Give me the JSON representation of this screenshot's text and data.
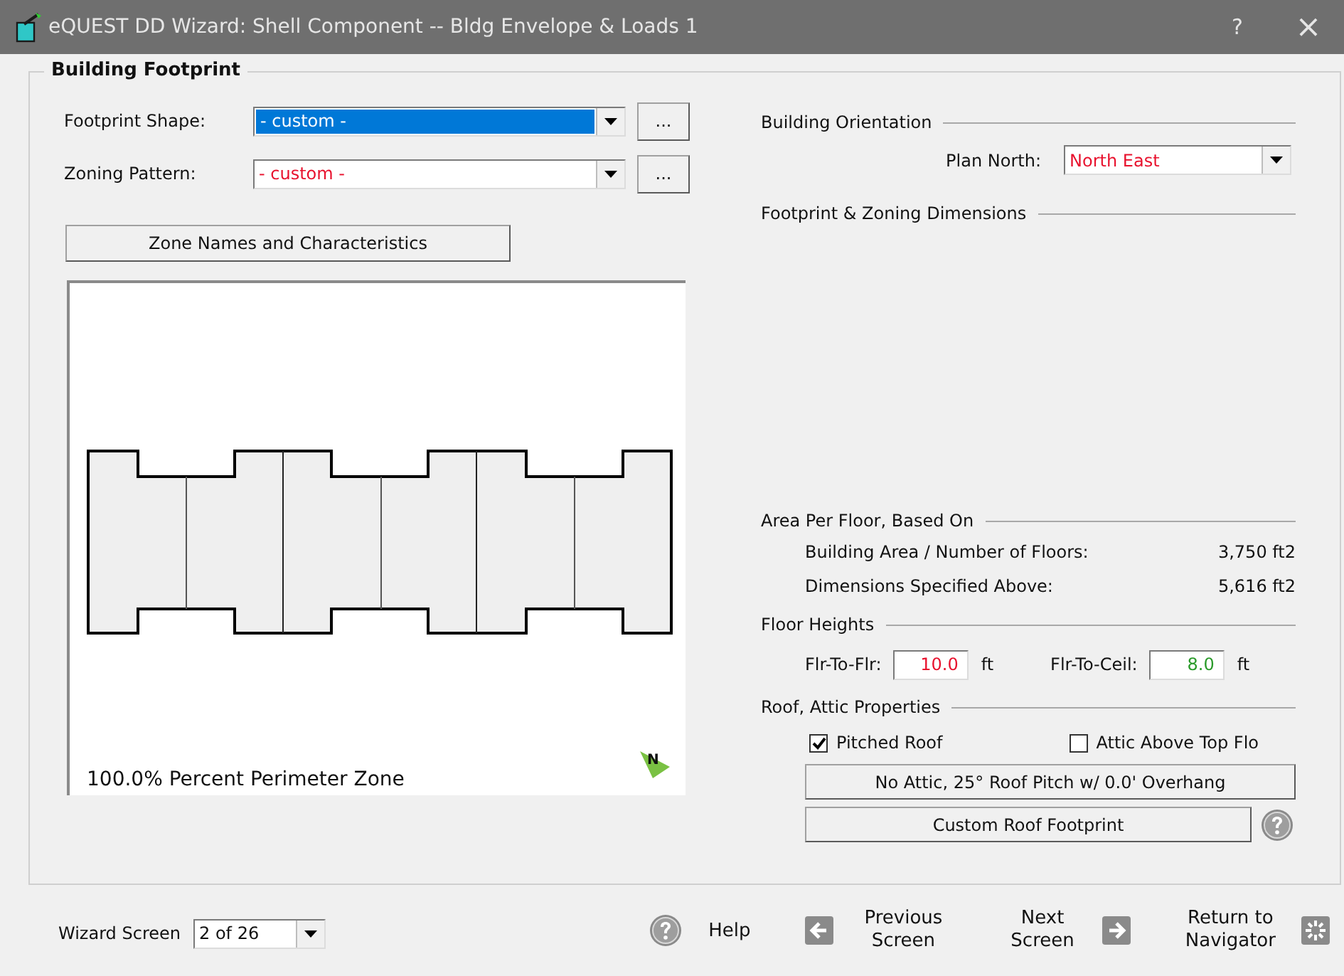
{
  "window": {
    "title": "eQUEST DD Wizard:  Shell Component  --  Bldg Envelope & Loads 1",
    "help_glyph": "?",
    "close_glyph": "×"
  },
  "group": {
    "title": "Building Footprint",
    "selectors": [
      {
        "label": "Footprint Shape:",
        "value": "- custom -",
        "kind": "user",
        "highlighted": true,
        "button": "..."
      },
      {
        "label": "Zoning Pattern:",
        "value": "- custom -",
        "kind": "user",
        "highlighted": false,
        "button": "..."
      }
    ],
    "zone_button": "Zone Names and Characteristics",
    "canvas": {
      "caption": "100.0% Percent Perimeter Zone",
      "north_label": "N"
    },
    "orientation": {
      "heading": "Building Orientation",
      "label": "Plan North:",
      "value": "North East",
      "kind": "user"
    },
    "dimensions_heading": "Footprint & Zoning Dimensions",
    "area": {
      "heading": "Area Per Floor, Based On",
      "rows": [
        {
          "label": "Building Area / Number of Floors:",
          "value": "3,750 ft2"
        },
        {
          "label": "Dimensions Specified Above:",
          "value": "5,616 ft2"
        }
      ]
    },
    "floor_heights": {
      "heading": "Floor Heights",
      "fields": [
        {
          "label": "Flr-To-Flr:",
          "value": "10.0",
          "unit": "ft",
          "kind": "user"
        },
        {
          "label": "Flr-To-Ceil:",
          "value": "8.0",
          "unit": "ft",
          "kind": "default"
        }
      ]
    },
    "roof": {
      "heading": "Roof, Attic Properties",
      "checkboxes": [
        {
          "label": "Pitched Roof",
          "checked": true
        },
        {
          "label": "Attic Above Top Flo",
          "checked": false
        }
      ],
      "summary_button": "No Attic, 25° Roof Pitch w/ 0.0' Overhang",
      "footprint_button": "Custom Roof Footprint"
    }
  },
  "footer": {
    "wizard_label": "Wizard Screen",
    "wizard_value": "2 of 26",
    "help": "Help",
    "previous": [
      "Previous",
      "Screen"
    ],
    "next": [
      "Next",
      "Screen"
    ],
    "return": [
      "Return to",
      "Navigator"
    ]
  }
}
